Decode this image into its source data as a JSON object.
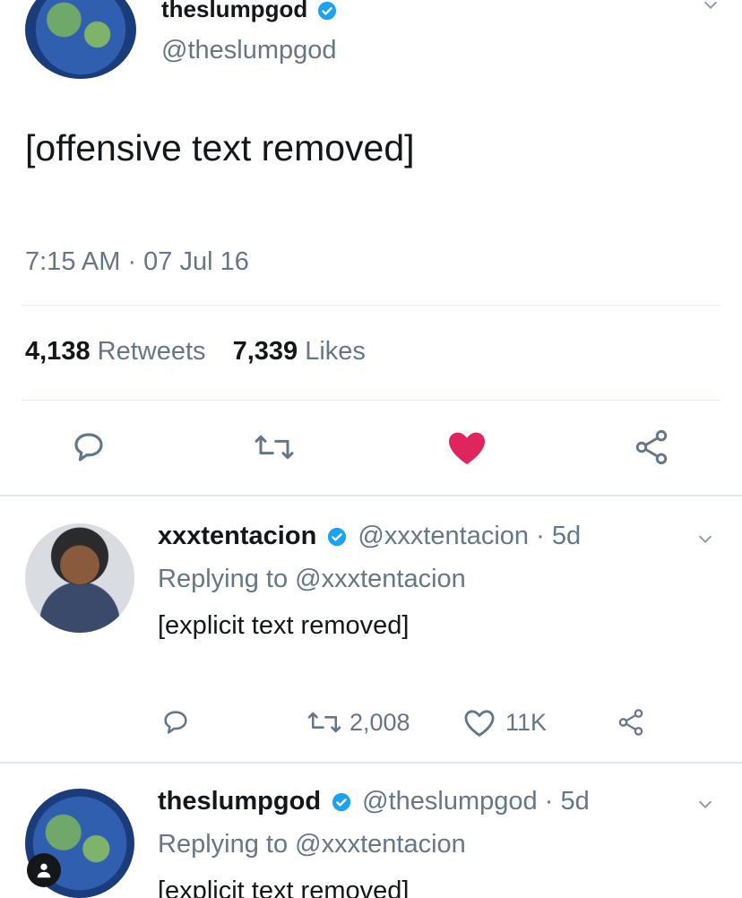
{
  "main_tweet": {
    "display_name": "theslumpgod",
    "handle": "@theslumpgod",
    "text_line1": "[offensive text removed]",
    "text_line2": "",
    "timestamp": "7:15 AM · 07 Jul 16",
    "retweets_count": "4,138",
    "retweets_label": "Retweets",
    "likes_count": "7,339",
    "likes_label": "Likes"
  },
  "reply1": {
    "display_name": "xxxtentacion",
    "handle_time": "@xxxtentacion · 5d",
    "replying_to": "Replying to @xxxtentacion",
    "text_line1": "[explicit text removed]",
    "text_line2": "",
    "retweet_count": "2,008",
    "like_count": "11K"
  },
  "reply2": {
    "display_name": "theslumpgod",
    "handle_time": "@theslumpgod · 5d",
    "replying_to": "Replying to @xxxtentacion",
    "text_line1": "[explicit text removed]"
  },
  "colors": {
    "heart": "#e0245e",
    "verified": "#1da1f2",
    "muted": "#657786"
  },
  "icons": [
    "verified-icon",
    "reply-icon",
    "retweet-icon",
    "heart-icon",
    "share-icon",
    "chevron-down-icon",
    "camera-icon"
  ]
}
